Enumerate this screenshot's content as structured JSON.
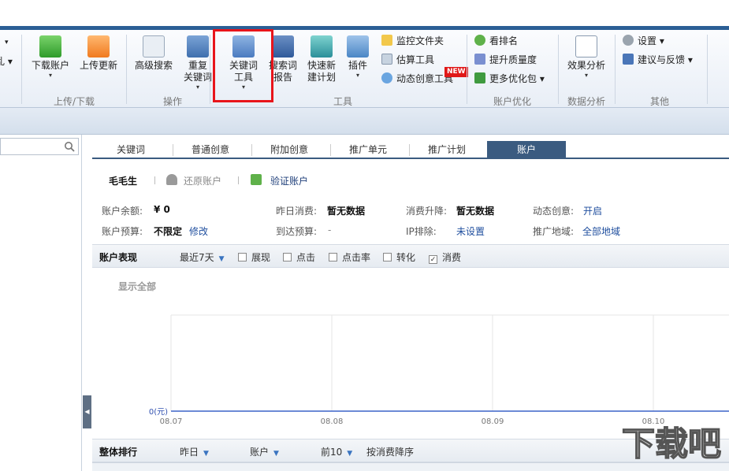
{
  "ribbon": {
    "partial_left": {
      "top": "▾",
      "bottom": "乱 ▾"
    },
    "download": {
      "label": "下载账户",
      "dd": "▾"
    },
    "upload": {
      "label": "上传更新"
    },
    "group_updown": "上传/下载",
    "adv_search": {
      "label": "高级搜索"
    },
    "dup_kw": {
      "line1": "重复",
      "line2": "关键词",
      "dd": "▾"
    },
    "group_ops": "操作",
    "kw_tool": {
      "line1": "关键词",
      "line2": "工具",
      "dd": "▾"
    },
    "search_report": {
      "line1": "搜索词",
      "line2": "报告"
    },
    "quick_plan": {
      "line1": "快速新",
      "line2": "建计划"
    },
    "plugin": {
      "label": "插件",
      "dd": "▾"
    },
    "monitor": "监控文件夹",
    "estimate": "估算工具",
    "dynamic": "动态创意工具",
    "new_badge": "NEW",
    "group_tools": "工具",
    "rank": "看排名",
    "quality": "提升质量度",
    "more_opt": "更多优化包 ▾",
    "group_account_opt": "账户优化",
    "effect": {
      "label": "效果分析",
      "dd": "▾"
    },
    "group_data": "数据分析",
    "settings": "设置 ▾",
    "feedback": "建议与反馈 ▾",
    "group_other": "其他"
  },
  "tabs": [
    "关键词",
    "普通创意",
    "附加创意",
    "推广单元",
    "推广计划",
    "账户"
  ],
  "account": {
    "name": "毛毛生",
    "restore": "还原账户",
    "verify": "验证账户",
    "balance_label": "账户余额:",
    "balance_value": "¥ 0",
    "yday_label": "昨日消费:",
    "yday_value": "暂无数据",
    "change_label": "消费升降:",
    "change_value": "暂无数据",
    "dynamic_label": "动态创意:",
    "dynamic_value": "开启",
    "budget_label": "账户预算:",
    "budget_value": "不限定",
    "budget_edit": "修改",
    "arrive_label": "到达预算:",
    "arrive_value": "-",
    "ip_label": "IP排除:",
    "ip_value": "未设置",
    "region_label": "推广地域:",
    "region_value": "全部地域"
  },
  "perf": {
    "title": "账户表现",
    "range": "最近7天",
    "metrics": [
      {
        "label": "展现",
        "checked": false
      },
      {
        "label": "点击",
        "checked": false
      },
      {
        "label": "点击率",
        "checked": false
      },
      {
        "label": "转化",
        "checked": false
      },
      {
        "label": "消费",
        "checked": true
      }
    ],
    "show_all": "显示全部",
    "check_mark": "✓"
  },
  "chart_data": {
    "type": "line",
    "x": [
      "08.07",
      "08.08",
      "08.09",
      "08.10"
    ],
    "series": [],
    "y_tick": "0(元)"
  },
  "ranking": {
    "title": "整体排行",
    "period": "昨日",
    "scope": "账户",
    "top": "前10",
    "sort": "按消费降序"
  },
  "watermark": "下载吧",
  "colors": {
    "accent": "#3b5b80",
    "highlight": "#e8151b",
    "link": "#1f4e9e"
  }
}
